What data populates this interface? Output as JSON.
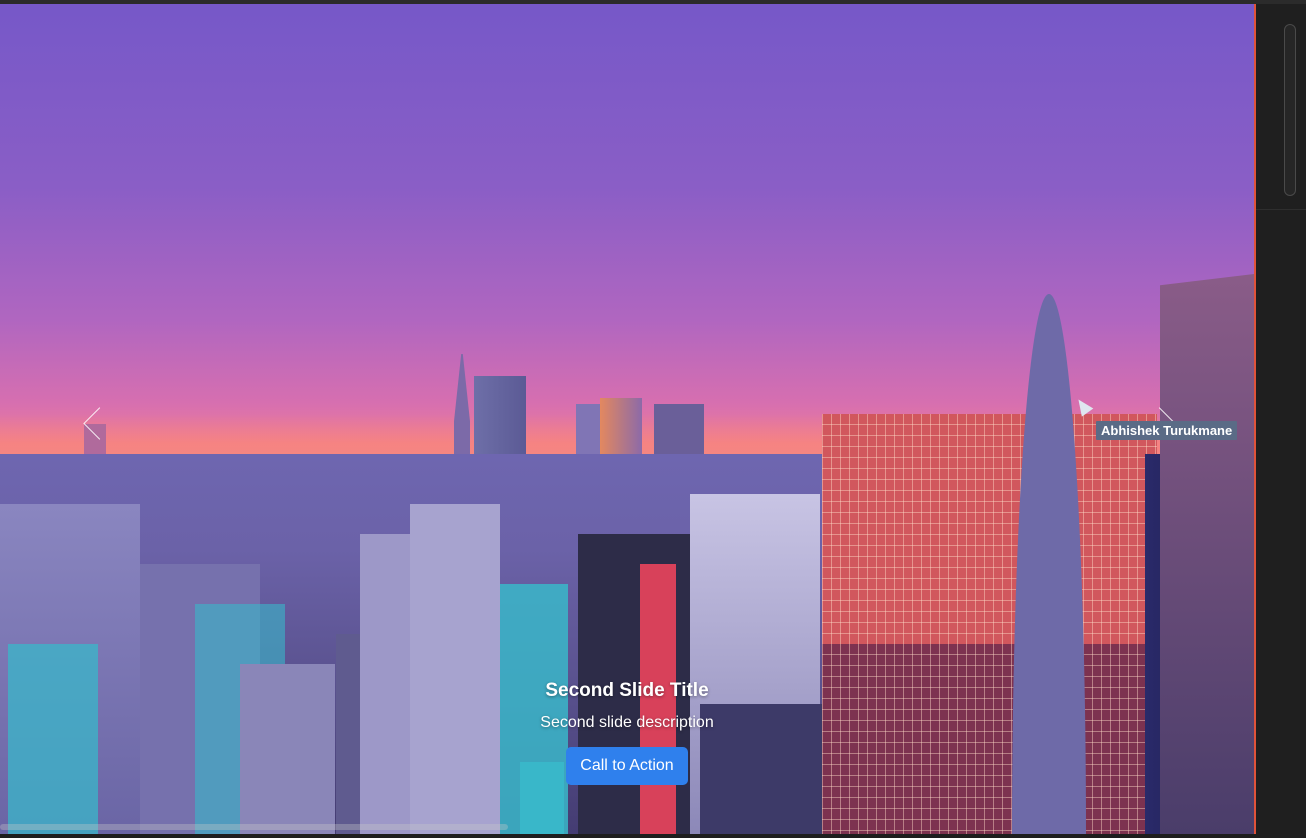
{
  "slide": {
    "title": "Second Slide Title",
    "description": "Second slide description",
    "cta_label": "Call to Action"
  },
  "controls": {
    "prev_icon": "chevron-left-icon",
    "next_icon": "chevron-right-icon"
  },
  "tooltip": {
    "text": "Abhishek Turukmane"
  },
  "colors": {
    "cta_background": "#2f80ed",
    "viewport_border": "#e0533a",
    "tooltip_background": "#5a6b86"
  }
}
